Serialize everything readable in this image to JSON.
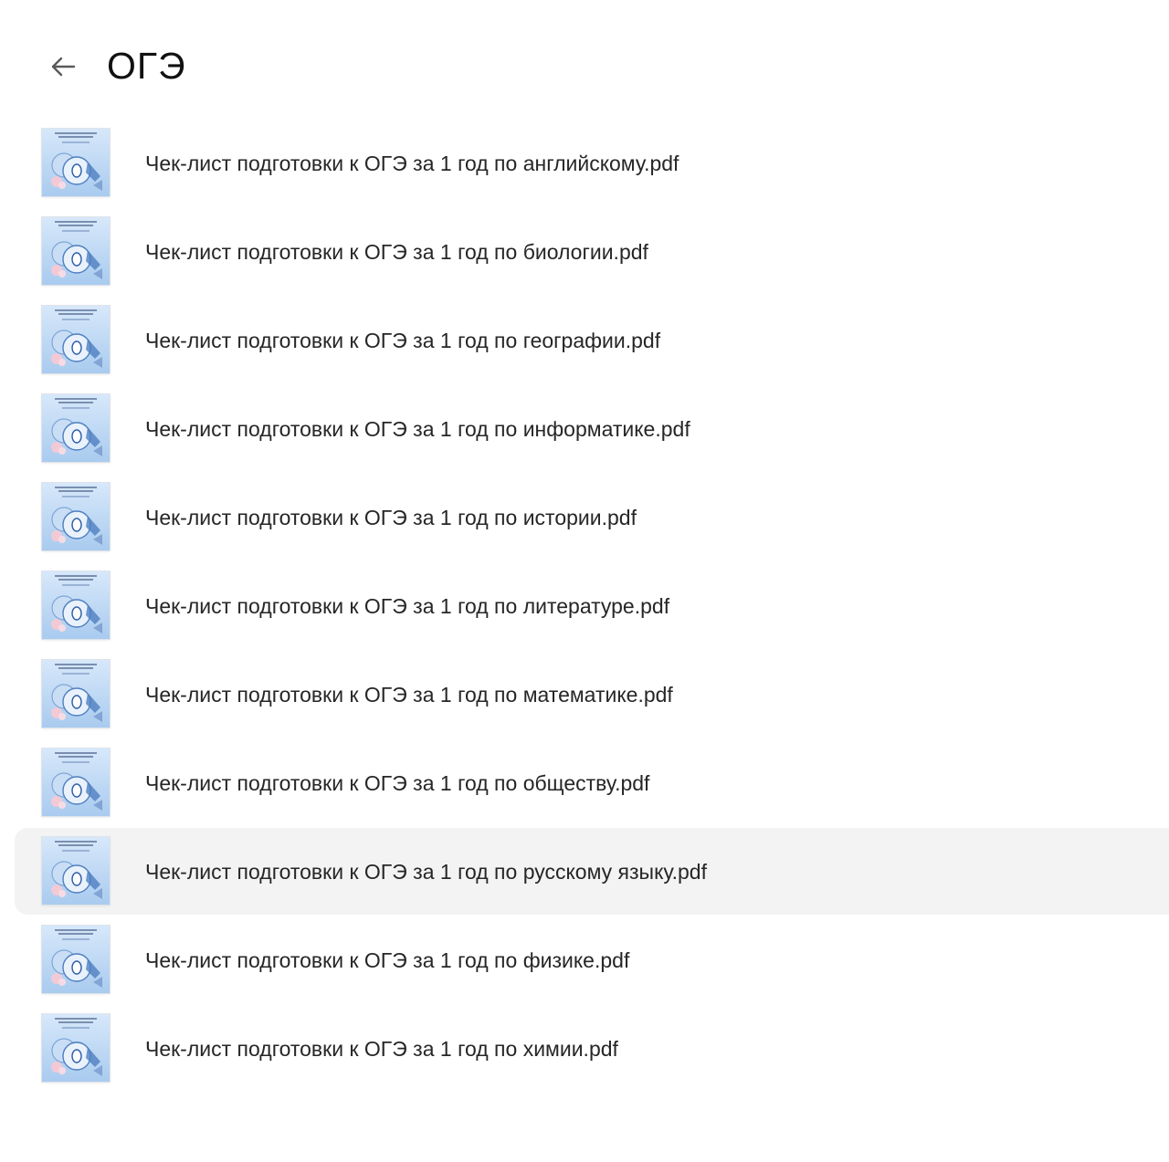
{
  "header": {
    "back_icon": "arrow-left-icon",
    "title": "ОГЭ"
  },
  "files": [
    {
      "name": "Чек-лист подготовки к ОГЭ за 1 год по английскому.pdf",
      "selected": false
    },
    {
      "name": "Чек-лист подготовки к ОГЭ за 1 год по биологии.pdf",
      "selected": false
    },
    {
      "name": "Чек-лист подготовки к ОГЭ за 1 год по географии.pdf",
      "selected": false
    },
    {
      "name": "Чек-лист подготовки к ОГЭ за 1 год по информатике.pdf",
      "selected": false
    },
    {
      "name": "Чек-лист подготовки к ОГЭ за 1 год по истории.pdf",
      "selected": false
    },
    {
      "name": "Чек-лист подготовки к ОГЭ за 1 год по литературе.pdf",
      "selected": false
    },
    {
      "name": "Чек-лист подготовки к ОГЭ за 1 год по математике.pdf",
      "selected": false
    },
    {
      "name": "Чек-лист подготовки к ОГЭ за 1 год по обществу.pdf",
      "selected": false
    },
    {
      "name": "Чек-лист подготовки к ОГЭ за 1 год по русскому языку.pdf",
      "selected": true
    },
    {
      "name": "Чек-лист подготовки к ОГЭ за 1 год по физике.pdf",
      "selected": false
    },
    {
      "name": "Чек-лист подготовки к ОГЭ за 1 год по химии.pdf",
      "selected": false
    }
  ],
  "colors": {
    "selected_row_bg": "#f3f3f4",
    "thumb_blue": "#bcd7f3",
    "text": "#262626"
  }
}
